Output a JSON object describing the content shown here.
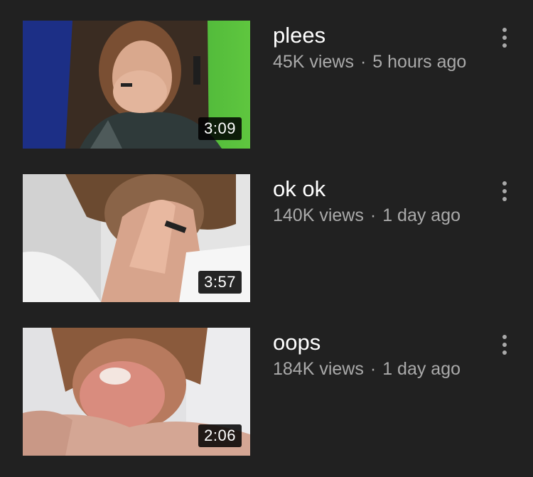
{
  "videos": [
    {
      "title": "plees",
      "views": "45K views",
      "separator": "·",
      "age": "5 hours ago",
      "duration": "3:09",
      "menu_icon": "more-vert-icon"
    },
    {
      "title": "ok ok",
      "views": "140K views",
      "separator": "·",
      "age": "1 day ago",
      "duration": "3:57",
      "menu_icon": "more-vert-icon"
    },
    {
      "title": "oops",
      "views": "184K views",
      "separator": "·",
      "age": "1 day ago",
      "duration": "2:06",
      "menu_icon": "more-vert-icon"
    }
  ],
  "colors": {
    "background": "#212121",
    "title": "#ffffff",
    "meta": "#aaaaaa",
    "duration_badge": "#000000"
  }
}
